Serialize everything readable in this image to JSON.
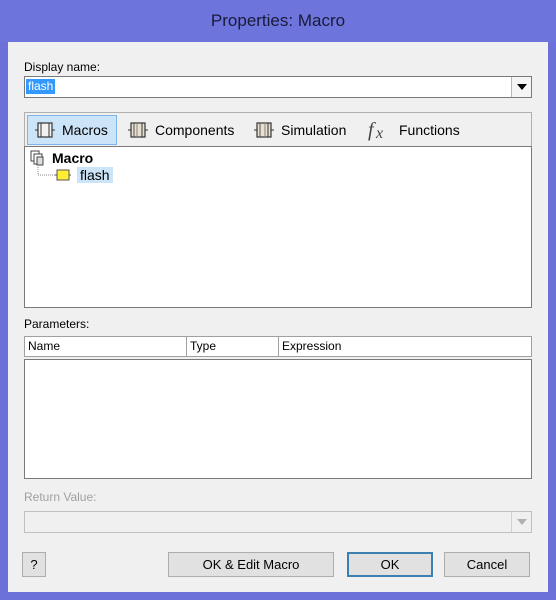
{
  "window": {
    "title": "Properties: Macro"
  },
  "display_name": {
    "label": "Display name:",
    "value": "flash"
  },
  "tabs": [
    {
      "label": "Macros",
      "icon": "macro-icon",
      "active": true
    },
    {
      "label": "Components",
      "icon": "component-icon",
      "active": false
    },
    {
      "label": "Simulation",
      "icon": "simulation-icon",
      "active": false
    },
    {
      "label": "Functions",
      "icon": "fx-icon",
      "active": false
    }
  ],
  "tree": {
    "root": {
      "label": "Macro",
      "icon": "macro-folder-icon"
    },
    "children": [
      {
        "label": "flash",
        "icon": "macro-item-icon"
      }
    ]
  },
  "parameters": {
    "label": "Parameters:",
    "columns": [
      "Name",
      "Type",
      "Expression"
    ]
  },
  "return_value": {
    "label": "Return Value:",
    "value": ""
  },
  "buttons": {
    "help": "?",
    "ok_edit": "OK & Edit Macro",
    "ok": "OK",
    "cancel": "Cancel"
  },
  "colors": {
    "accent": "#6b71d9",
    "selection": "#3399ff",
    "active_tab": "#cce4f7"
  }
}
